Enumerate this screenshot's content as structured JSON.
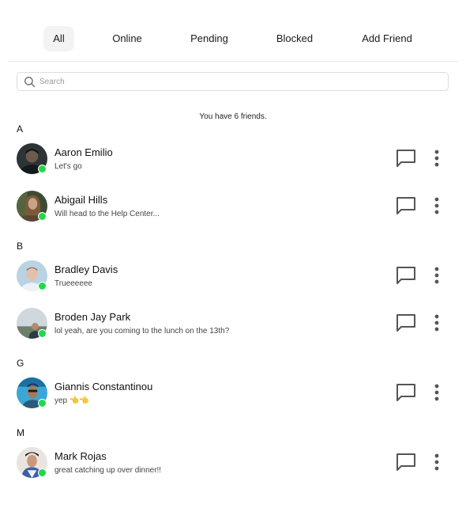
{
  "tabs": [
    {
      "label": "All",
      "active": true
    },
    {
      "label": "Online",
      "active": false
    },
    {
      "label": "Pending",
      "active": false
    },
    {
      "label": "Blocked",
      "active": false
    },
    {
      "label": "Add Friend",
      "active": false
    }
  ],
  "search": {
    "placeholder": "Search",
    "value": "",
    "icon": "search-icon"
  },
  "summary": "You have 6 friends.",
  "colors": {
    "online": "#22d84a",
    "active_tab_bg": "#f3f3f3",
    "icon": "#555555"
  },
  "groups": [
    {
      "letter": "A",
      "friends": [
        {
          "name": "Aaron Emilio",
          "message": "Let's go",
          "online": true
        },
        {
          "name": "Abigail Hills",
          "message": "Will head to the Help Center...",
          "online": true
        }
      ]
    },
    {
      "letter": "B",
      "friends": [
        {
          "name": "Bradley Davis",
          "message": "Trueeeeee",
          "online": true
        },
        {
          "name": "Broden Jay Park",
          "message": "lol yeah, are you coming to the lunch on the 13th?",
          "online": true
        }
      ]
    },
    {
      "letter": "G",
      "friends": [
        {
          "name": "Giannis Constantinou",
          "message": "yep 👈👈",
          "online": true
        }
      ]
    },
    {
      "letter": "M",
      "friends": [
        {
          "name": "Mark Rojas",
          "message": "great catching up over dinner!!",
          "online": true
        }
      ]
    }
  ],
  "row_actions": {
    "chat_icon": "chat-bubble-icon",
    "more_icon": "more-vertical-icon"
  }
}
